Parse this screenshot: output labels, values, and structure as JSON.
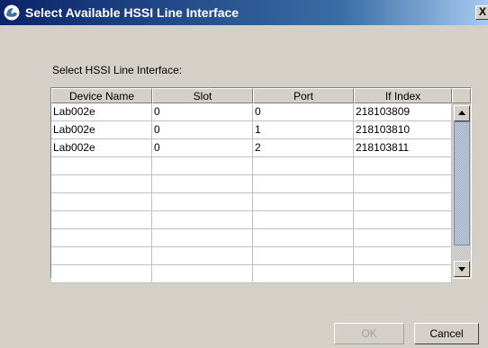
{
  "window": {
    "title": "Select Available HSSI Line Interface",
    "close_glyph": "X"
  },
  "prompt": "Select HSSI Line Interface:",
  "table": {
    "columns": [
      "Device Name",
      "Slot",
      "Port",
      "If Index"
    ],
    "rows": [
      [
        "Lab002e",
        "0",
        "0",
        "218103809"
      ],
      [
        "Lab002e",
        "0",
        "1",
        "218103810"
      ],
      [
        "Lab002e",
        "0",
        "2",
        "218103811"
      ],
      [
        "",
        "",
        "",
        ""
      ],
      [
        "",
        "",
        "",
        ""
      ],
      [
        "",
        "",
        "",
        ""
      ],
      [
        "",
        "",
        "",
        ""
      ],
      [
        "",
        "",
        "",
        ""
      ],
      [
        "",
        "",
        "",
        ""
      ],
      [
        "",
        "",
        "",
        ""
      ]
    ]
  },
  "buttons": {
    "ok_label": "OK",
    "ok_enabled": false,
    "cancel_label": "Cancel"
  },
  "icons": {
    "title": "app-icon",
    "scroll_up": "arrow-up-icon",
    "scroll_down": "arrow-down-icon"
  },
  "colors": {
    "titlebar_start": "#0a246a",
    "titlebar_end": "#a6caf0",
    "dialog_bg": "#d4d0c8"
  }
}
